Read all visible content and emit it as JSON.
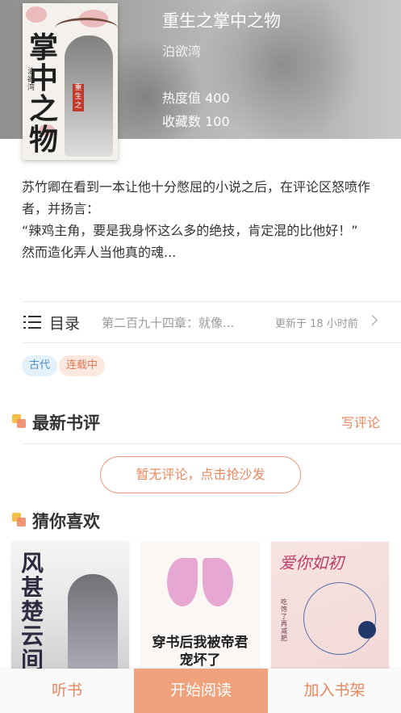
{
  "book": {
    "title": "重生之掌中之物",
    "author": "泊欲湾",
    "hot": "热度值 400",
    "favorites": "收藏数 100",
    "cover": {
      "title": "掌中之物",
      "author": "泊欲湾",
      "seal": "重生之"
    }
  },
  "synopsis": [
    "苏竹卿在看到一本让他十分憋屈的小说之后，在评论区怒喷作者，并扬言：",
    "“辣鸡主角，要是我身怀这么多的绝技，肯定混的比他好！”",
    "然而造化弄人当他真的魂..."
  ],
  "catalog": {
    "label": "目录",
    "latest_chapter": "第二百九十四章：就像...",
    "updated": "更新于 18 小时前"
  },
  "tags": [
    "古代",
    "连载中"
  ],
  "reviews": {
    "title": "最新书评",
    "write_label": "写评论",
    "empty_label": "暂无评论，点击抢沙发"
  },
  "recommend": {
    "title": "猜你喜欢",
    "books": [
      {
        "cover_text": "风甚楚云间"
      },
      {
        "cover_text": "穿书后我被帝君宠坏了"
      },
      {
        "cover_text": "爱你如初",
        "author": "吃饱了再减肥"
      }
    ]
  },
  "bottom_bar": {
    "listen": "听书",
    "read": "开始阅读",
    "add_shelf": "加入书架"
  },
  "colors": {
    "accent": "#e9875e",
    "accent_fill": "#f0a27c",
    "tag_blue": "#4a90c8",
    "tag_orange": "#e27a5a"
  }
}
